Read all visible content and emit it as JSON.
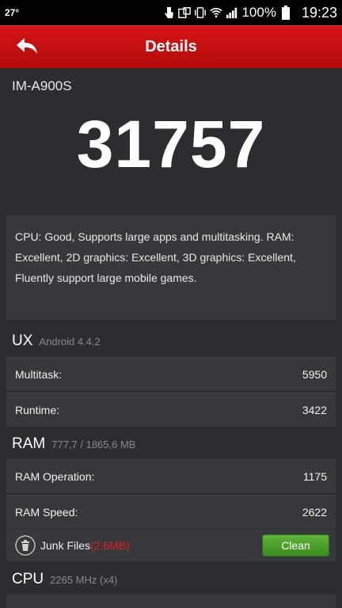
{
  "status": {
    "temperature": "27°",
    "battery": "100%",
    "time": "19:23"
  },
  "header": {
    "title": "Details"
  },
  "device": {
    "name": "IM-A900S"
  },
  "score": "31757",
  "description": "CPU: Good, Supports large apps and multitasking. RAM: Excellent, 2D graphics: Excellent, 3D graphics: Excellent, Fluently support large mobile games.",
  "ux": {
    "title": "UX",
    "subtitle": "Android 4.4.2",
    "rows": [
      {
        "label": "Multitask:",
        "value": "5950"
      },
      {
        "label": "Runtime:",
        "value": "3422"
      }
    ]
  },
  "ram": {
    "title": "RAM",
    "subtitle": "777,7 / 1865,6 MB",
    "rows": [
      {
        "label": "RAM Operation:",
        "value": "1175"
      },
      {
        "label": "RAM Speed:",
        "value": "2622"
      }
    ],
    "junk": {
      "label": "Junk Files",
      "open": "(",
      "size": "2,6MB",
      "close": ")",
      "button": "Clean"
    }
  },
  "cpu": {
    "title": "CPU",
    "subtitle": "2265 MHz (x4)"
  },
  "colors": {
    "header": "#c41010",
    "accent_green": "#4a9f2a",
    "junk_size": "#e21f1f"
  }
}
